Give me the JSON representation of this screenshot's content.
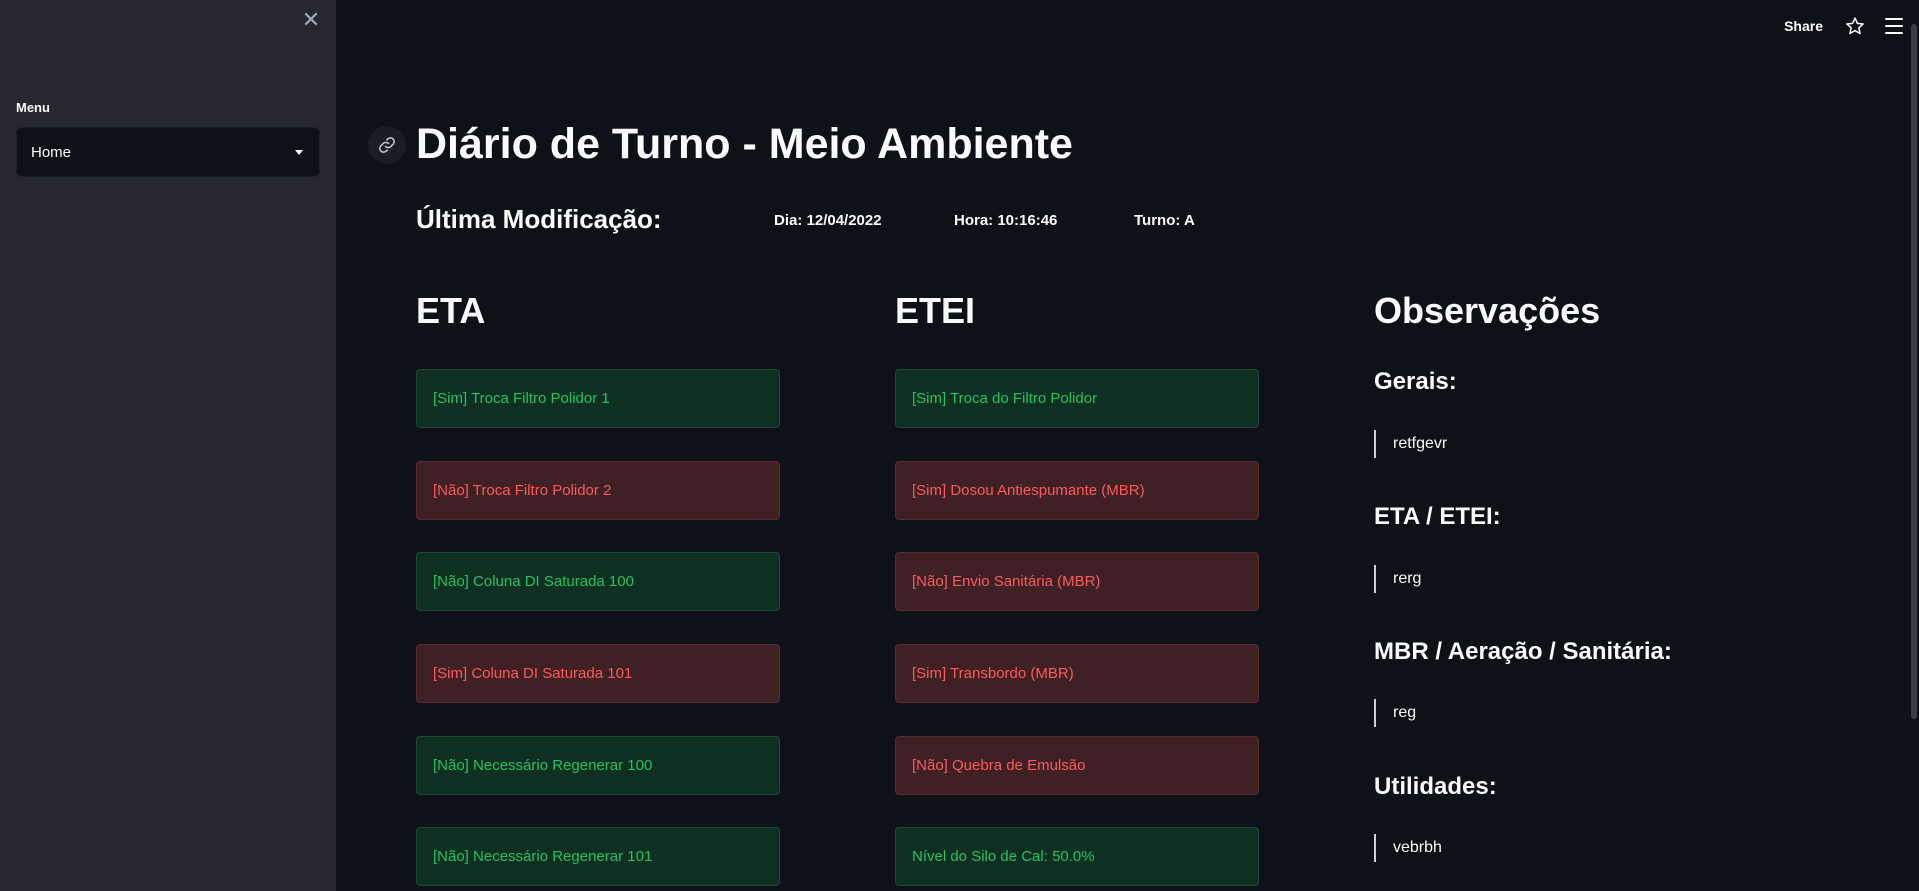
{
  "sidebar": {
    "close_icon": "✕",
    "menu_label": "Menu",
    "select_value": "Home"
  },
  "topbar": {
    "share_label": "Share"
  },
  "header": {
    "title": "Diário de Turno - Meio Ambiente",
    "last_modified_label": "Última Modificação:",
    "day": "Dia: 12/04/2022",
    "hour": "Hora: 10:16:46",
    "shift": "Turno: A"
  },
  "eta": {
    "heading": "ETA",
    "items": [
      {
        "label": "[Sim] Troca Filtro Polidor 1",
        "status": "ok"
      },
      {
        "label": "[Não] Troca Filtro Polidor 2",
        "status": "bad"
      },
      {
        "label": "[Não] Coluna DI Saturada 100",
        "status": "ok"
      },
      {
        "label": "[Sim] Coluna DI Saturada 101",
        "status": "bad"
      },
      {
        "label": "[Não] Necessário Regenerar 100",
        "status": "ok"
      },
      {
        "label": "[Não] Necessário Regenerar 101",
        "status": "ok"
      }
    ]
  },
  "etei": {
    "heading": "ETEI",
    "items": [
      {
        "label": "[Sim] Troca do Filtro Polidor",
        "status": "ok"
      },
      {
        "label": "[Sim] Dosou Antiespumante (MBR)",
        "status": "bad"
      },
      {
        "label": "[Não] Envio Sanitária (MBR)",
        "status": "bad"
      },
      {
        "label": "[Sim] Transbordo (MBR)",
        "status": "bad"
      },
      {
        "label": "[Não] Quebra de Emulsão",
        "status": "bad"
      },
      {
        "label": "Nível do Silo de Cal: 50.0%",
        "status": "ok"
      }
    ]
  },
  "observacoes": {
    "heading": "Observações",
    "sections": [
      {
        "title": "Gerais:",
        "text": "retfgevr"
      },
      {
        "title": "ETA / ETEI:",
        "text": "rerg"
      },
      {
        "title": "MBR / Aeração / Sanitária:",
        "text": "reg"
      },
      {
        "title": "Utilidades:",
        "text": "vebrbh"
      }
    ]
  },
  "colors": {
    "ok_bg": "#0f2f22",
    "ok_text": "#23c45e",
    "bad_bg": "#3e2025",
    "bad_text": "#ff5a5a"
  }
}
